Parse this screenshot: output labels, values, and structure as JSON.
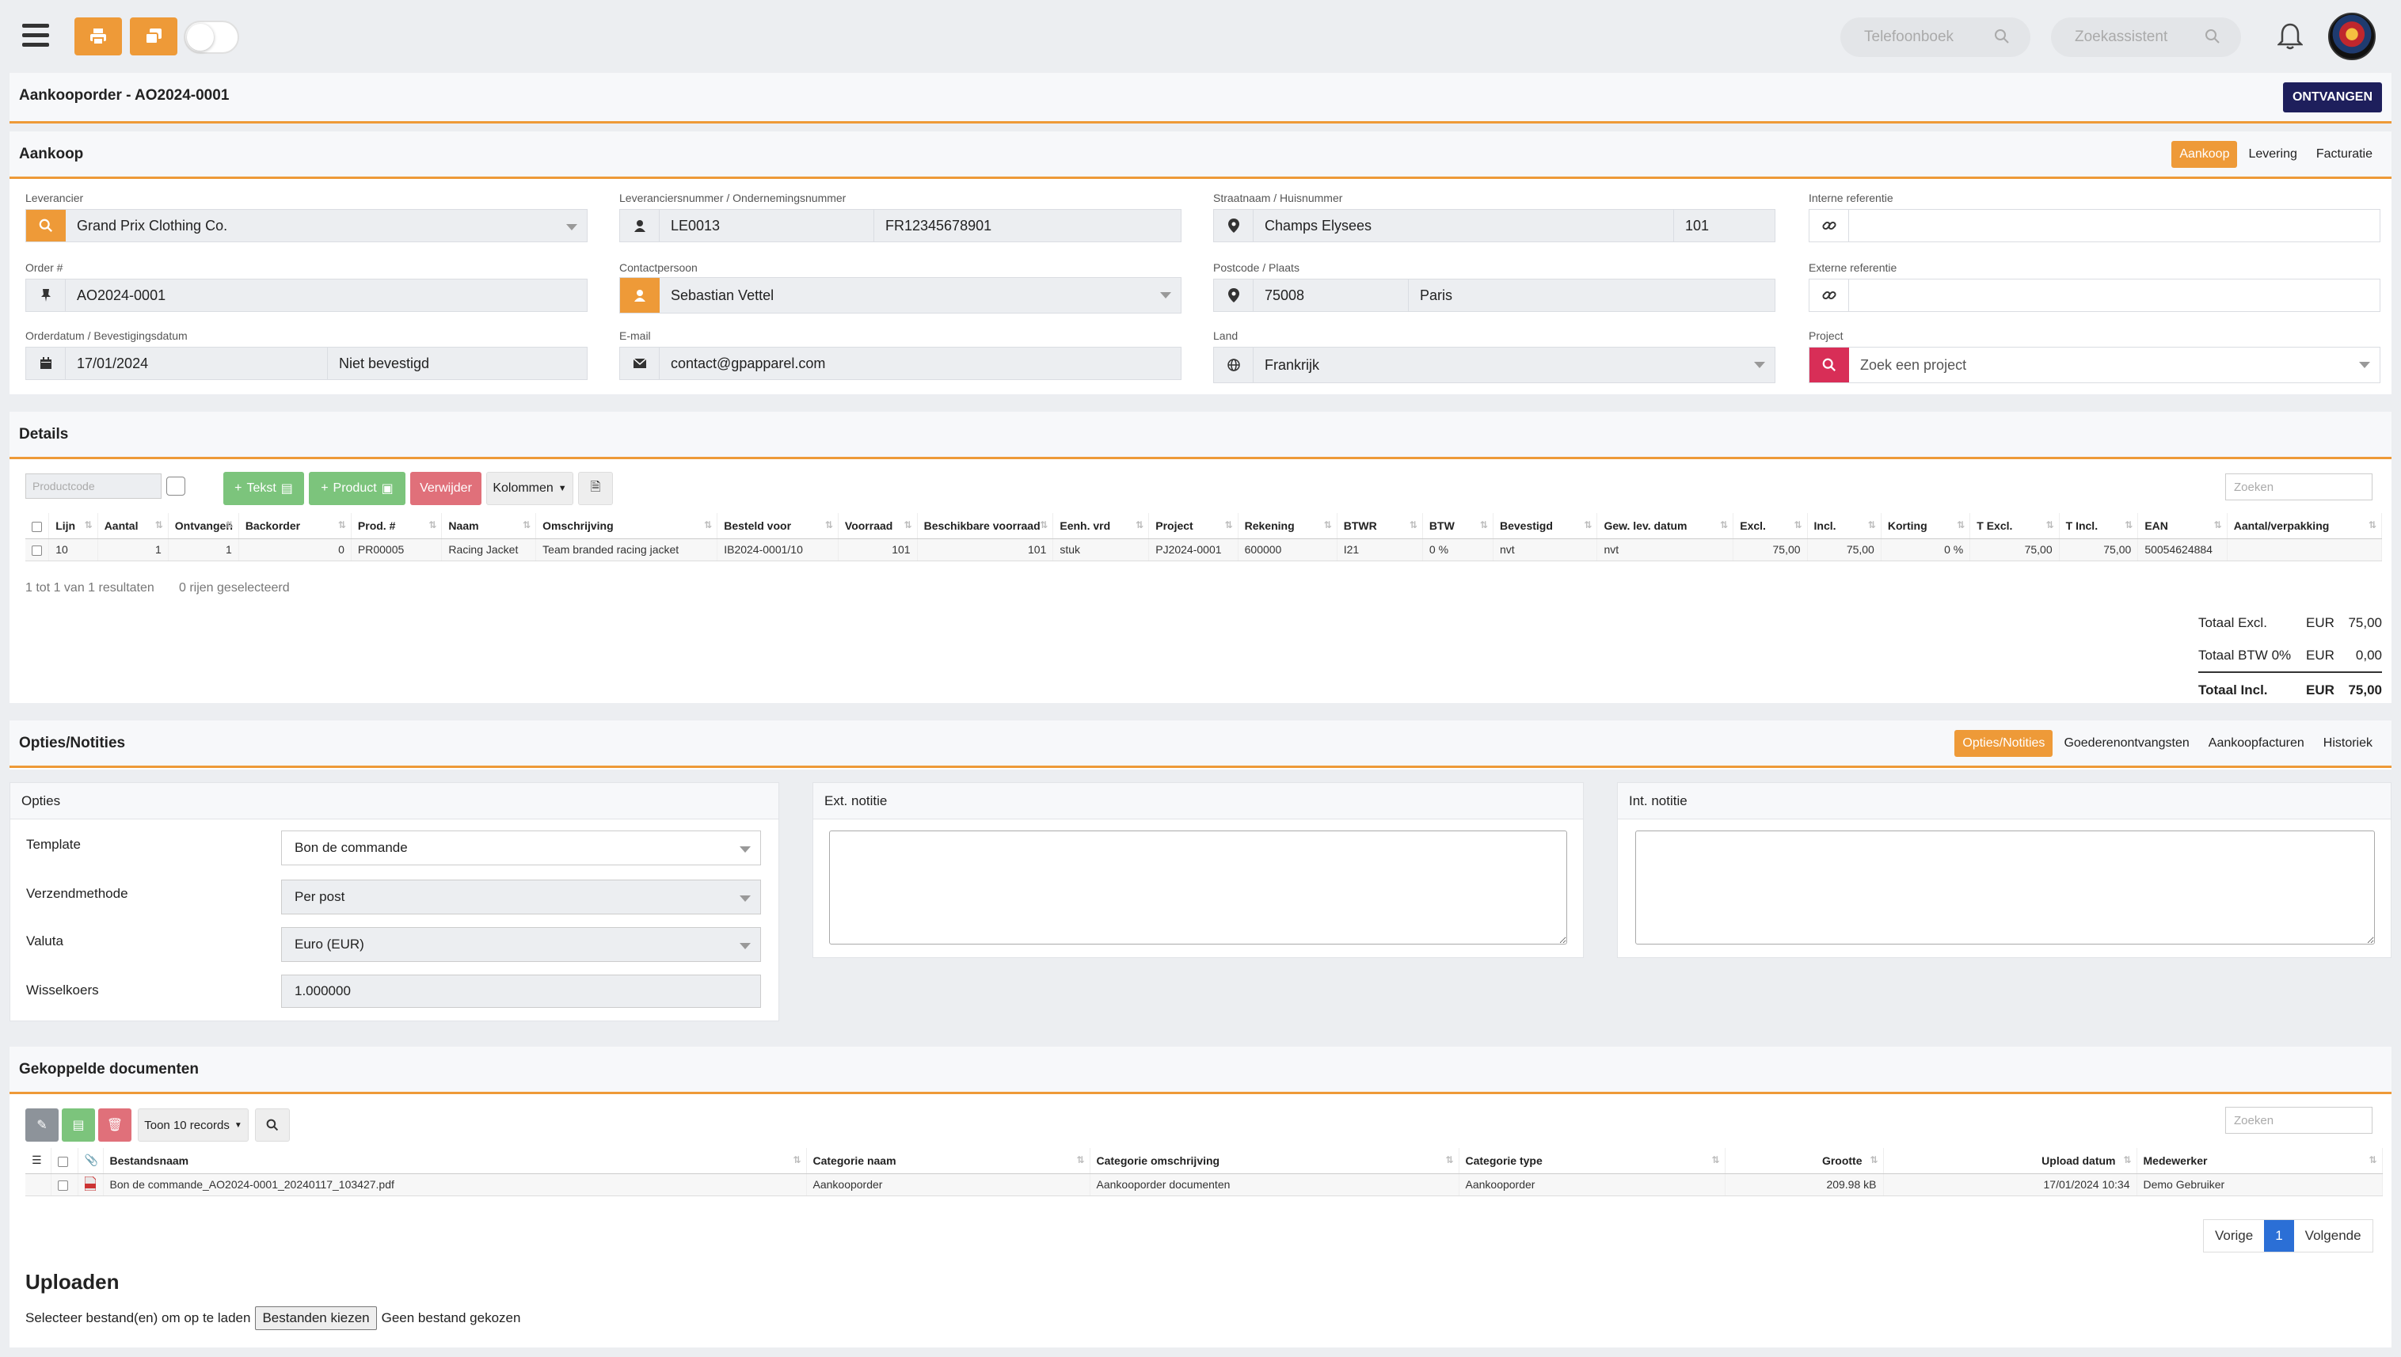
{
  "topbar": {
    "phonebook_placeholder": "Telefoonboek",
    "search_assistant_placeholder": "Zoekassistent"
  },
  "header": {
    "title": "Aankooporder - AO2024-0001",
    "receive_button": "ONTVANGEN"
  },
  "purchase": {
    "title": "Aankoop",
    "tabs": [
      "Aankoop",
      "Levering",
      "Facturatie"
    ],
    "supplier_label": "Leverancier",
    "supplier_value": "Grand Prix Clothing Co.",
    "supplier_numbers_label": "Leveranciersnummer / Ondernemingsnummer",
    "supplier_number": "LE0013",
    "company_number": "FR12345678901",
    "street_label": "Straatnaam / Huisnummer",
    "street": "Champs Elysees",
    "house_number": "101",
    "internal_ref_label": "Interne referentie",
    "internal_ref": "",
    "order_label": "Order #",
    "order_value": "AO2024-0001",
    "contact_label": "Contactpersoon",
    "contact_value": "Sebastian Vettel",
    "postcode_label": "Postcode / Plaats",
    "postcode": "75008",
    "city": "Paris",
    "external_ref_label": "Externe referentie",
    "external_ref": "",
    "date_label": "Orderdatum / Bevestigingsdatum",
    "order_date": "17/01/2024",
    "confirmation": "Niet bevestigd",
    "email_label": "E-mail",
    "email": "contact@gpapparel.com",
    "country_label": "Land",
    "country": "Frankrijk",
    "project_label": "Project",
    "project_placeholder": "Zoek een project"
  },
  "details": {
    "title": "Details",
    "productcode_placeholder": "Productcode",
    "btn_text": "Tekst",
    "btn_product": "Product",
    "btn_delete": "Verwijder",
    "btn_columns": "Kolommen",
    "search_placeholder": "Zoeken",
    "columns": [
      "Lijn",
      "Aantal",
      "Ontvangen",
      "Backorder",
      "Prod. #",
      "Naam",
      "Omschrijving",
      "Besteld voor",
      "Voorraad",
      "Beschikbare voorraad",
      "Eenh. vrd",
      "Project",
      "Rekening",
      "BTWR",
      "BTW",
      "Bevestigd",
      "Gew. lev. datum",
      "Excl.",
      "Incl.",
      "Korting",
      "T Excl.",
      "T Incl.",
      "EAN",
      "Aantal/verpakking"
    ],
    "rows": [
      [
        "10",
        "1",
        "1",
        "0",
        "PR00005",
        "Racing Jacket",
        "Team branded racing jacket",
        "IB2024-0001/10",
        "101",
        "101",
        "stuk",
        "PJ2024-0001",
        "600000",
        "I21",
        "0 %",
        "nvt",
        "nvt",
        "75,00",
        "75,00",
        "0 %",
        "75,00",
        "75,00",
        "50054624884",
        ""
      ]
    ],
    "result_info": "1 tot 1 van 1 resultaten",
    "selected_info": "0 rijen geselecteerd",
    "totals": {
      "excl_label": "Totaal Excl.",
      "excl_cur": "EUR",
      "excl_value": "75,00",
      "vat_label": "Totaal BTW 0%",
      "vat_cur": "EUR",
      "vat_value": "0,00",
      "incl_label": "Totaal Incl.",
      "incl_cur": "EUR",
      "incl_value": "75,00"
    }
  },
  "options": {
    "title": "Opties/Notities",
    "tabs": [
      "Opties/Notities",
      "Goederenontvangsten",
      "Aankoopfacturen",
      "Historiek"
    ],
    "opties_title": "Opties",
    "template_label": "Template",
    "template_value": "Bon de commande",
    "shipping_label": "Verzendmethode",
    "shipping_value": "Per post",
    "currency_label": "Valuta",
    "currency_value": "Euro (EUR)",
    "rate_label": "Wisselkoers",
    "rate_value": "1.000000",
    "ext_note_title": "Ext. notitie",
    "int_note_title": "Int. notitie"
  },
  "documents": {
    "title": "Gekoppelde documenten",
    "show_records": "Toon 10 records",
    "search_placeholder": "Zoeken",
    "columns": [
      "Bestandsnaam",
      "Categorie naam",
      "Categorie omschrijving",
      "Categorie type",
      "Grootte",
      "Upload datum",
      "Medewerker"
    ],
    "rows": [
      [
        "Bon de commande_AO2024-0001_20240117_103427.pdf",
        "Aankooporder",
        "Aankooporder documenten",
        "Aankooporder",
        "209.98 kB",
        "17/01/2024 10:34",
        "Demo Gebruiker"
      ]
    ],
    "pager_prev": "Vorige",
    "pager_current": "1",
    "pager_next": "Volgende"
  },
  "upload": {
    "title": "Uploaden",
    "instruction": "Selecteer bestand(en) om op te laden",
    "choose_button": "Bestanden kiezen",
    "no_file": "Geen bestand gekozen"
  }
}
